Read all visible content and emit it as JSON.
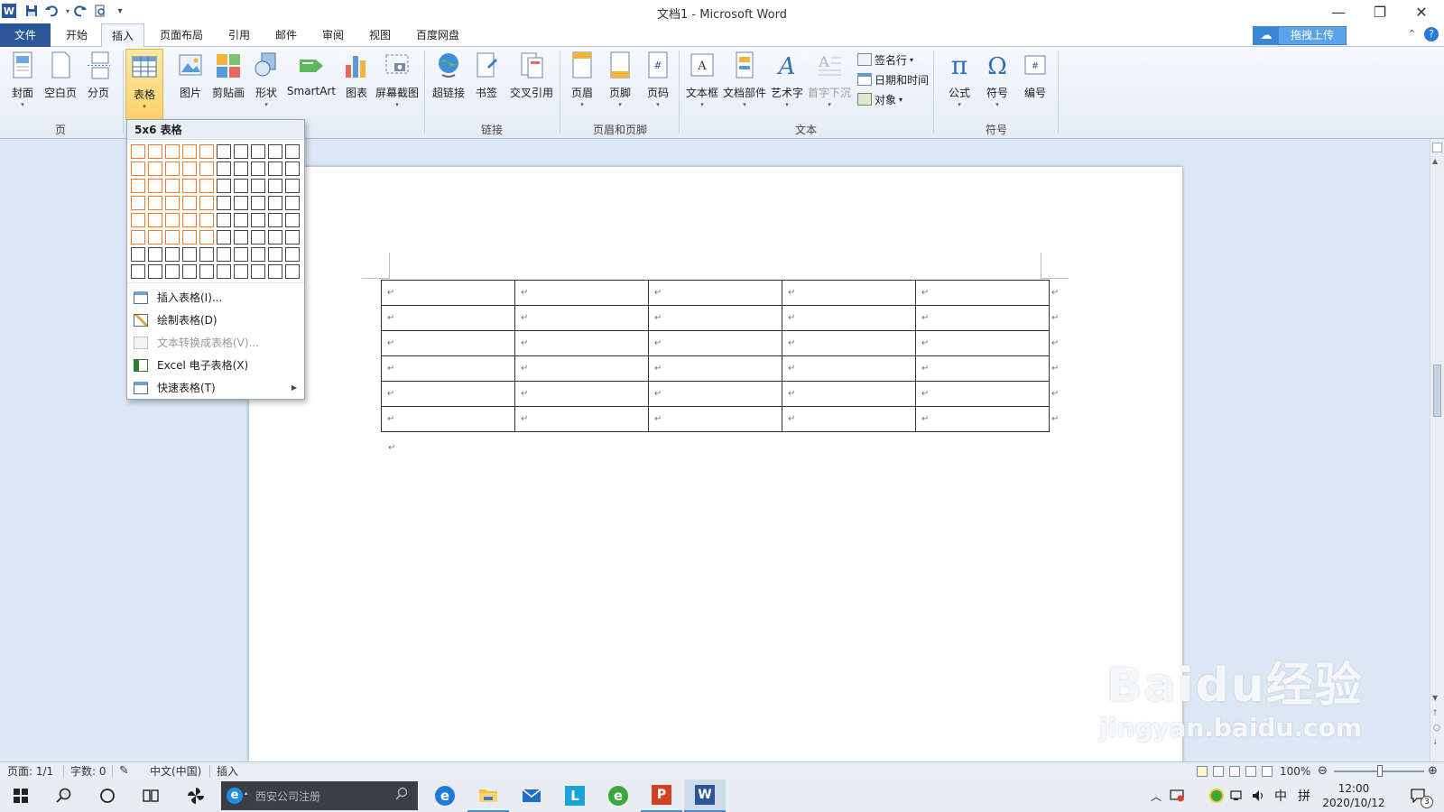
{
  "window": {
    "title": "文档1 - Microsoft Word"
  },
  "quick_access": {
    "word_icon": "W",
    "save_icon": "floppy-icon",
    "undo_icon": "undo-icon",
    "redo_icon": "redo-icon",
    "preview_icon": "print-preview-icon",
    "customize": "▾"
  },
  "window_controls": {
    "minimize": "—",
    "restore": "❐",
    "close": "✕"
  },
  "tabs": [
    "文件",
    "开始",
    "插入",
    "页面布局",
    "引用",
    "邮件",
    "审阅",
    "视图",
    "百度网盘"
  ],
  "active_tab": "插入",
  "upload_button": "拖拽上传",
  "ribbon": {
    "pages_group": {
      "label": "页",
      "buttons": [
        "封面",
        "空白页",
        "分页"
      ]
    },
    "table_button": "表格",
    "illustrations": [
      "图片",
      "剪贴画",
      "形状",
      "SmartArt",
      "图表",
      "屏幕截图"
    ],
    "links_group": {
      "label": "链接",
      "buttons": [
        "超链接",
        "书签",
        "交叉引用"
      ]
    },
    "header_footer_group": {
      "label": "页眉和页脚",
      "buttons": [
        "页眉",
        "页脚",
        "页码"
      ]
    },
    "text_group": {
      "label": "文本",
      "buttons": [
        "文本框",
        "文档部件",
        "艺术字",
        "首字下沉"
      ],
      "small": [
        "签名行",
        "日期和时间",
        "对象"
      ]
    },
    "symbols_group": {
      "label": "符号",
      "buttons": [
        "公式",
        "符号",
        "编号"
      ]
    }
  },
  "dropdown": {
    "header": "5x6 表格",
    "grid": {
      "cols": 10,
      "rows": 8,
      "sel_cols": 5,
      "sel_rows": 6
    },
    "items": [
      "插入表格(I)...",
      "绘制表格(D)",
      "文本转换成表格(V)...",
      "Excel 电子表格(X)",
      "快速表格(T)"
    ]
  },
  "document": {
    "rows": 6,
    "cols": 5,
    "cell_mark": "↵",
    "after_mark": "↵"
  },
  "status": {
    "page": "页面: 1/1",
    "words": "字数: 0",
    "language": "中文(中国)",
    "mode": "插入",
    "zoom": "100%"
  },
  "taskbar": {
    "search_placeholder": "西安公司注册",
    "clock_time": "12:00",
    "clock_date": "2020/10/12",
    "ime_lang": "中",
    "ime_mode": "拼",
    "notifications": "3"
  },
  "watermark": {
    "line1": "Baidu经验",
    "line2": "jingyan.baidu.com"
  }
}
